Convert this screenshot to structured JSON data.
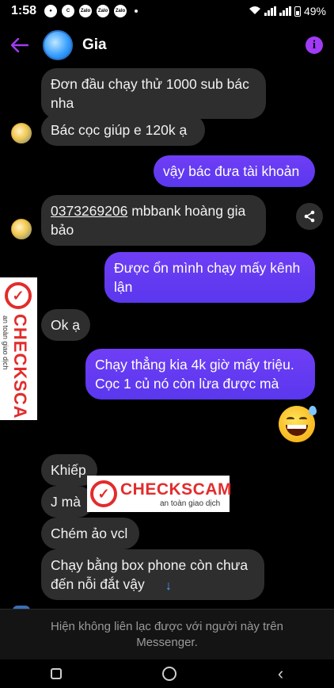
{
  "status_bar": {
    "time": "1:58",
    "battery": "49%",
    "notif_labels": [
      "Zalo",
      "Zalo",
      "Zalo"
    ]
  },
  "header": {
    "contact_name": "Gia"
  },
  "messages": [
    {
      "from": "them",
      "text": "Đơn đầu chạy thử 1000 sub bác nha"
    },
    {
      "from": "them",
      "text": "Bác cọc giúp e 120k ạ"
    },
    {
      "from": "me",
      "text": "vậy bác đưa tài khoản"
    },
    {
      "from": "them",
      "text_link": "0373269206",
      "text": " mbbank hoàng gia bảo"
    },
    {
      "from": "me",
      "text": "Được ổn mình chạy mấy kênh lận"
    },
    {
      "from": "them",
      "text": "Ok ạ"
    },
    {
      "from": "me",
      "text": "Chạy thẳng kia 4k giờ mấy triệu. Cọc 1 củ nó còn lừa được mà"
    },
    {
      "from": "me",
      "emoji": "sweat-smile-emoji"
    },
    {
      "from": "them",
      "text": "Khiếp"
    },
    {
      "from": "them",
      "text": "J mà"
    },
    {
      "from": "them",
      "text": "Chém ảo vcl"
    },
    {
      "from": "them",
      "text": "Chạy bằng box phone còn chưa đến nỗi đắt vậy"
    }
  ],
  "watermark": {
    "brand": "CHECKSCAM",
    "tagline": "an toàn giao dịch"
  },
  "notice": {
    "line1": "Hiện không liên lạc được với người này trên",
    "line2": "Messenger."
  },
  "colors": {
    "accent": "#a13bf7",
    "outgoing": "#6236f5",
    "incoming": "#2e2e2e",
    "watermark": "#e22c2c"
  }
}
